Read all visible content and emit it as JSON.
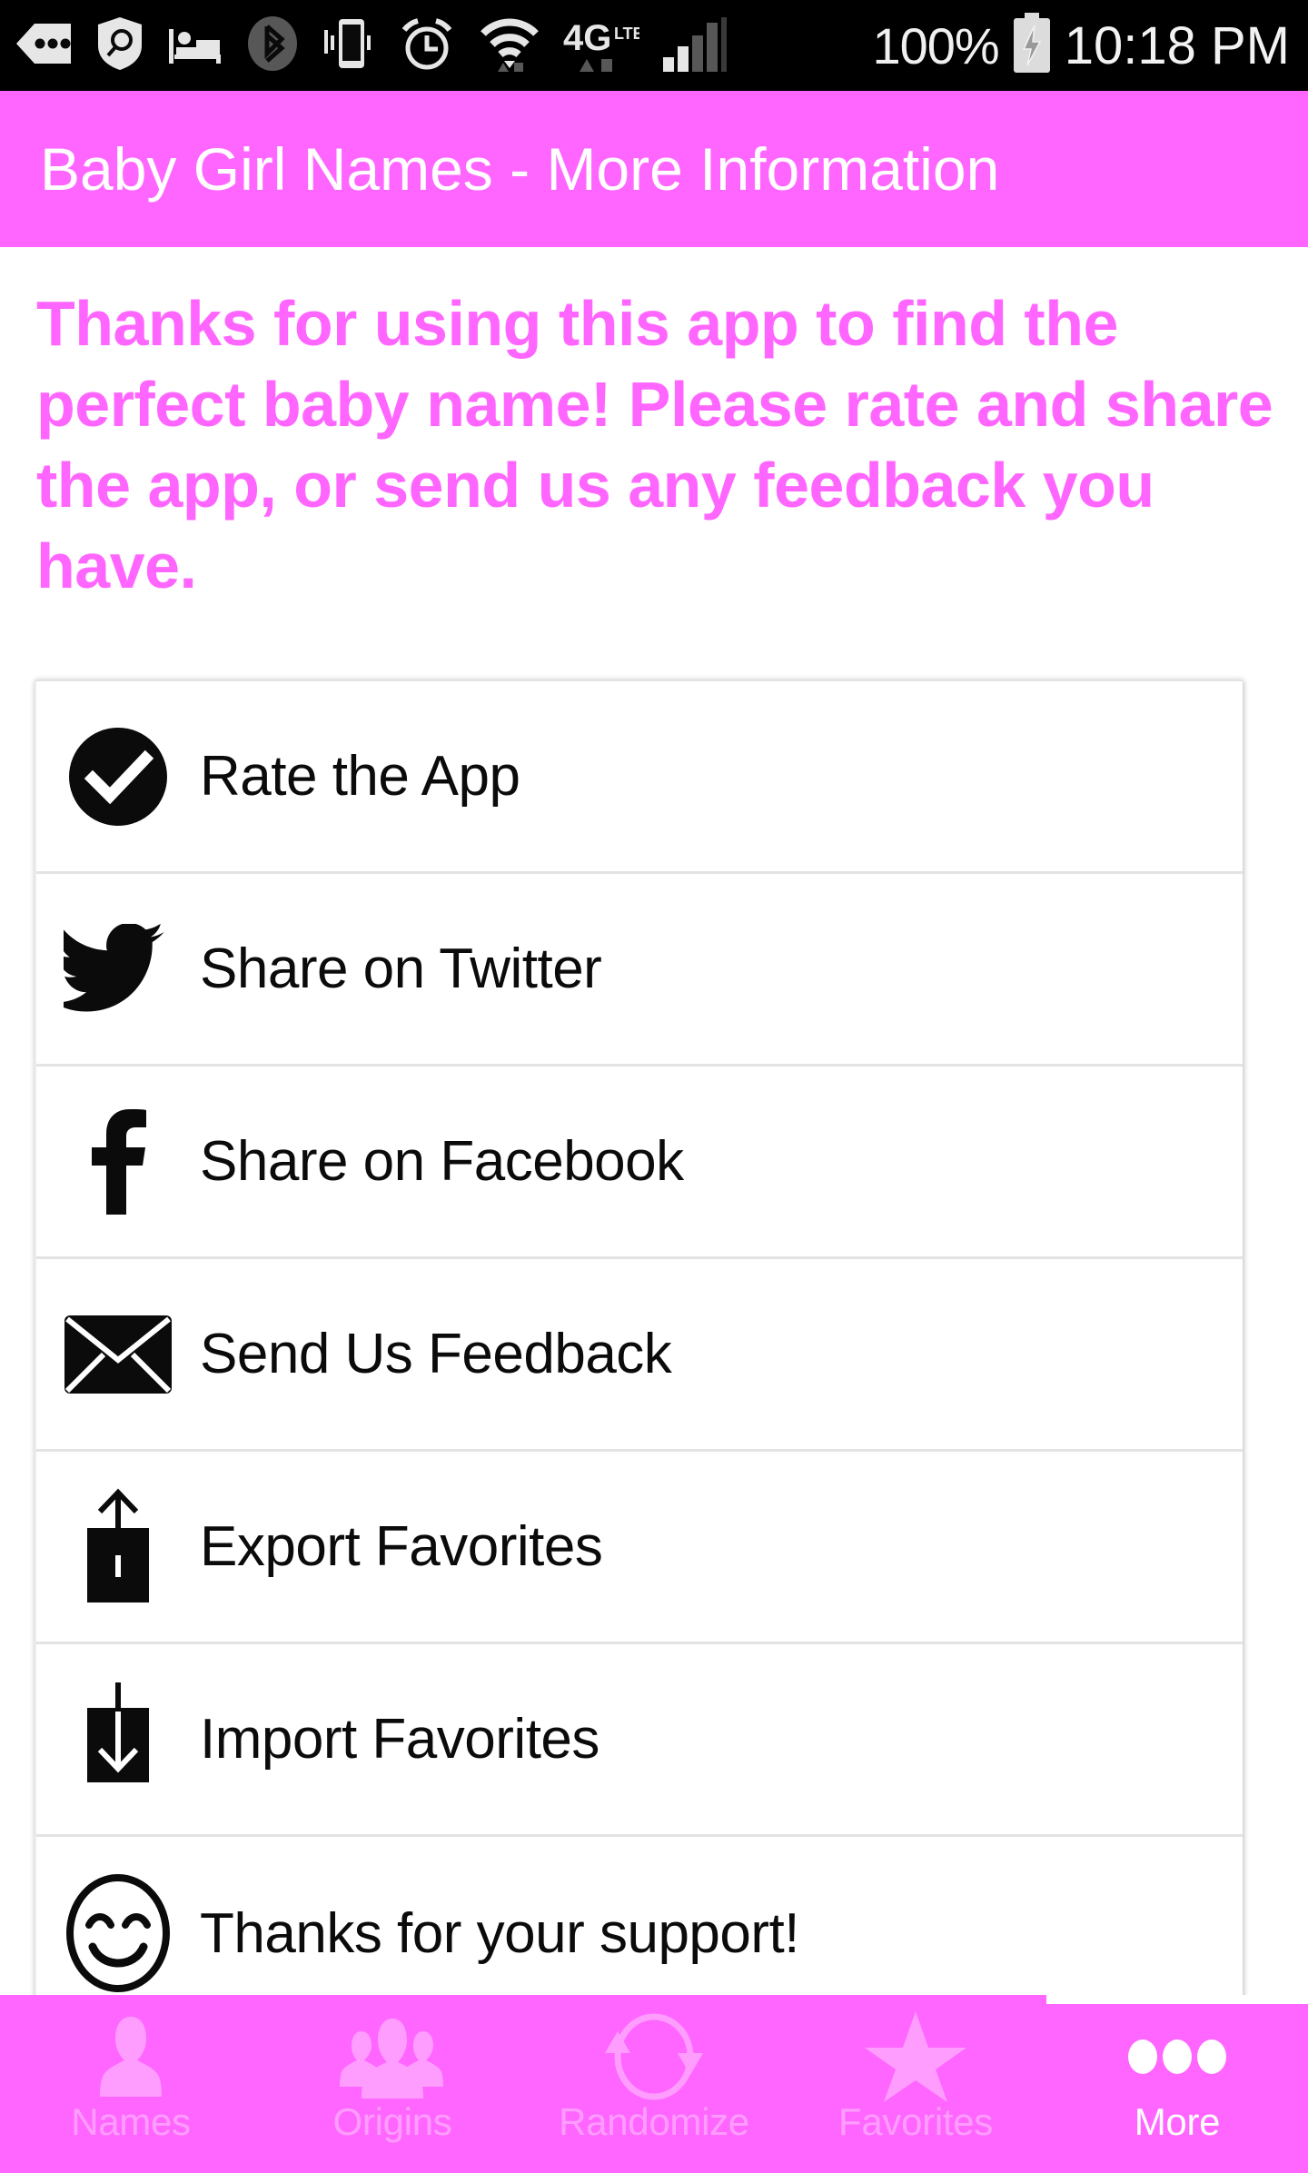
{
  "statusbar": {
    "icons_left": [
      "back-arrow-dots-icon",
      "shield-search-icon",
      "bed-icon",
      "bluetooth-icon",
      "vibrate-icon",
      "alarm-clock-icon",
      "wifi-icon",
      "network-4glte-icon",
      "signal-bars-icon"
    ],
    "battery_percent": "100%",
    "battery_icon": "battery-charging-icon",
    "time": "10:18 PM"
  },
  "titlebar": {
    "title": "Baby Girl Names - More Information",
    "background": "#ff66ff",
    "text_color": "#ffffff"
  },
  "message": {
    "text": "Thanks for using this app to find the perfect baby name! Please rate and share the app, or send us any feedback you have.",
    "color": "#ff66ff"
  },
  "list": {
    "items": [
      {
        "icon": "check-circle-icon",
        "label": "Rate the App"
      },
      {
        "icon": "twitter-bird-icon",
        "label": "Share on Twitter"
      },
      {
        "icon": "facebook-f-icon",
        "label": "Share on Facebook"
      },
      {
        "icon": "envelope-icon",
        "label": "Send Us Feedback"
      },
      {
        "icon": "export-upload-icon",
        "label": "Export Favorites"
      },
      {
        "icon": "import-download-icon",
        "label": "Import Favorites"
      },
      {
        "icon": "smiley-face-icon",
        "label": "Thanks for your support!"
      }
    ]
  },
  "navbar": {
    "background": "#ff66ff",
    "inactive_color": "#ff9dff",
    "active_color": "#ffffff",
    "items": [
      {
        "icon": "person-icon",
        "label": "Names",
        "active": false
      },
      {
        "icon": "people-group-icon",
        "label": "Origins",
        "active": false
      },
      {
        "icon": "refresh-cycle-icon",
        "label": "Randomize",
        "active": false
      },
      {
        "icon": "star-icon",
        "label": "Favorites",
        "active": false
      },
      {
        "icon": "more-dots-icon",
        "label": "More",
        "active": true
      }
    ]
  }
}
